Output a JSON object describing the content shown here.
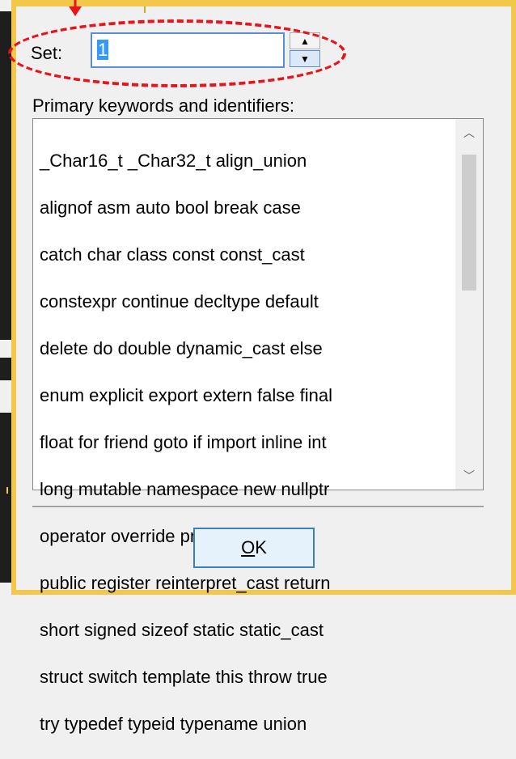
{
  "set": {
    "label": "Set:",
    "value": "1"
  },
  "keywords": {
    "label": "Primary keywords and identifiers:",
    "lines": [
      "_Char16_t _Char32_t align_union",
      "alignof asm auto bool break case",
      "catch char class const const_cast",
      "constexpr continue decltype default",
      "delete do double dynamic_cast else",
      "enum explicit export extern false final",
      "float for friend goto if import inline int",
      "long mutable namespace new nullptr",
      "operator override private protected",
      "public register reinterpret_cast return",
      "short signed sizeof static static_cast",
      "struct switch template this throw true",
      "try typedef typeid typename union"
    ]
  },
  "buttons": {
    "ok_accel": "O",
    "ok_rest": "K"
  },
  "icons": {
    "spin_up": "up-triangle-icon",
    "spin_down": "down-triangle-icon",
    "scroll_up": "chevron-up-icon",
    "scroll_down": "chevron-down-icon"
  },
  "colors": {
    "frame": "#f3c84a",
    "annotation": "#e8141c",
    "selection": "#3399ff",
    "focus_border": "#5b8dd8"
  }
}
